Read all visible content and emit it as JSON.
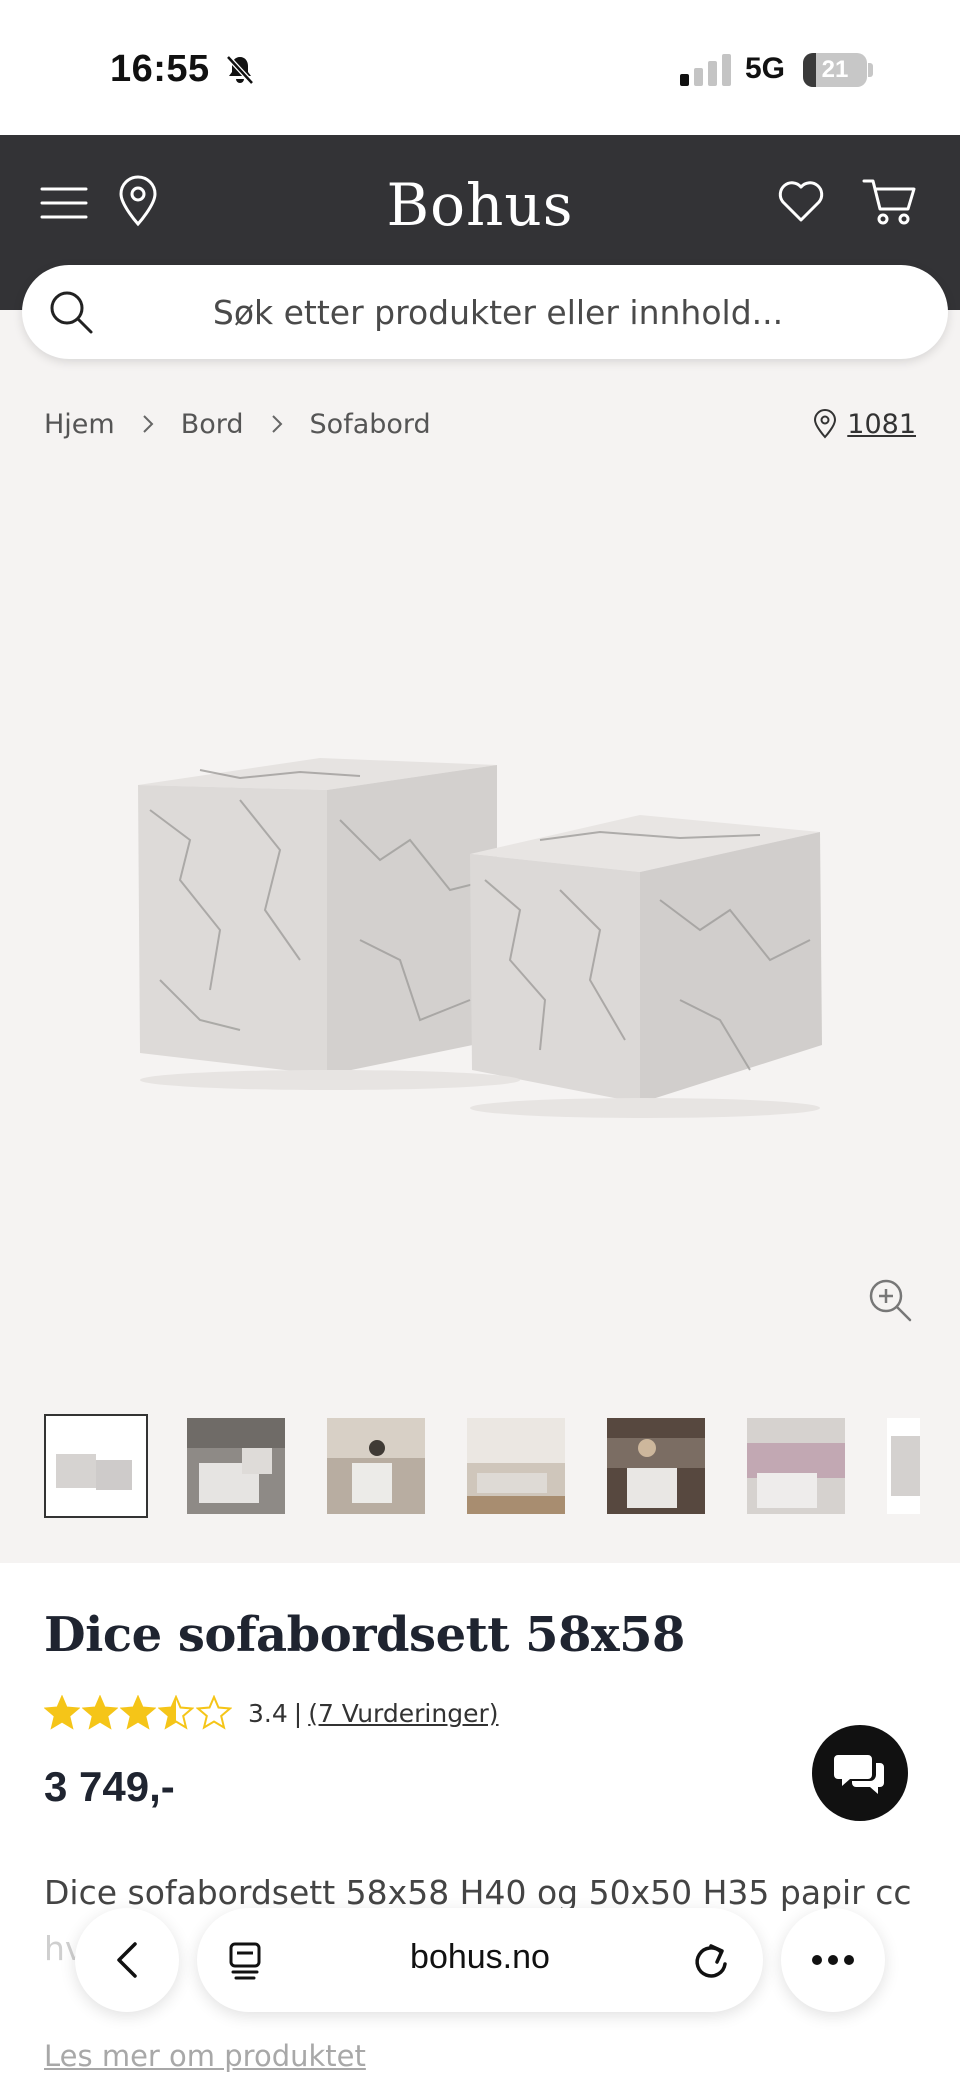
{
  "status_bar": {
    "time": "16:55",
    "network": "5G",
    "battery_level": "21",
    "battery_fraction": 0.21
  },
  "header": {
    "logo": "Bohus",
    "icons": [
      "menu-icon",
      "location-icon",
      "heart-icon",
      "cart-icon"
    ]
  },
  "search": {
    "placeholder": "Søk etter produkter eller innhold..."
  },
  "breadcrumb": {
    "items": [
      "Hjem",
      "Bord",
      "Sofabord"
    ],
    "store": "1081"
  },
  "gallery": {
    "thumbnail_count": 7,
    "selected_index": 0
  },
  "product": {
    "title": "Dice sofabordsett 58x58",
    "rating_value": "3.4",
    "rating_separator": "|",
    "rating_count": "(7 Vurderinger)",
    "rating_stars": 3.4,
    "price": "3 749,-",
    "description": "Dice sofabordsett 58x58 H40 og 50x50 H35 papir cc",
    "description_cont": "hv",
    "read_more": "Les mer om produktet"
  },
  "browser": {
    "url": "bohus.no"
  },
  "colors": {
    "header_bg": "#333336",
    "page_bg": "#f5f3f2",
    "star": "#f5c518",
    "title": "#1f2430"
  }
}
